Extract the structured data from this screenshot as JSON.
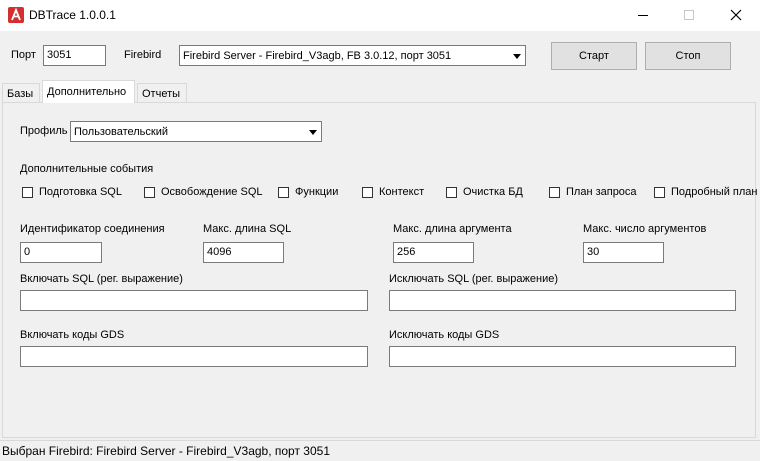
{
  "window": {
    "title": "DBTrace 1.0.0.1",
    "icon": "app-logo-icon"
  },
  "toolbar": {
    "port_label": "Порт",
    "port_value": "3051",
    "firebird_label": "Firebird",
    "firebird_selected": "Firebird Server - Firebird_V3agb, FB 3.0.12, порт 3051",
    "start_label": "Старт",
    "stop_label": "Стоп"
  },
  "tabs": [
    {
      "label": "Базы",
      "active": false
    },
    {
      "label": "Дополнительно",
      "active": true
    },
    {
      "label": "Отчеты",
      "active": false
    }
  ],
  "main": {
    "profile_label": "Профиль",
    "profile_selected": "Пользовательский",
    "extra_events_label": "Дополнительные события",
    "events": [
      {
        "label": "Подготовка SQL",
        "checked": false
      },
      {
        "label": "Освобождение SQL",
        "checked": false
      },
      {
        "label": "Функции",
        "checked": false
      },
      {
        "label": "Контекст",
        "checked": false
      },
      {
        "label": "Очистка БД",
        "checked": false
      },
      {
        "label": "План запроса",
        "checked": false
      },
      {
        "label": "Подробный план",
        "checked": false
      }
    ],
    "connection_id_label": "Идентификатор соединения",
    "connection_id_value": "0",
    "max_sql_len_label": "Макс. длина SQL",
    "max_sql_len_value": "4096",
    "max_arg_len_label": "Макс. длина аргумента",
    "max_arg_len_value": "256",
    "max_args_label": "Макс. число аргументов",
    "max_args_value": "30",
    "include_sql_label": "Включать SQL (рег. выражение)",
    "include_sql_value": "",
    "exclude_sql_label": "Исключать SQL (рег. выражение)",
    "exclude_sql_value": "",
    "include_gds_label": "Включать коды GDS",
    "include_gds_value": "",
    "exclude_gds_label": "Исключать коды GDS",
    "exclude_gds_value": ""
  },
  "status": {
    "text": "Выбран Firebird: Firebird Server - Firebird_V3agb, порт 3051"
  },
  "colors": {
    "background": "#f0f0f0",
    "app_icon": "#d32f2f"
  }
}
